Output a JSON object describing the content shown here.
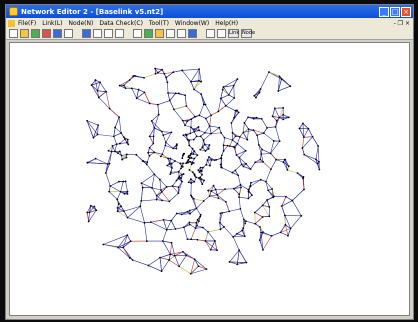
{
  "window": {
    "title": "Network Editor 2 - [Baselink v5.nt2]",
    "controls": [
      "minimize",
      "maximize",
      "close"
    ]
  },
  "menubar": {
    "items": [
      "File(F)",
      "Link(L)",
      "Node(N)",
      "Data Check(C)",
      "Tool(T)",
      "Window(W)",
      "Help(H)"
    ],
    "mdi_controls": "- ❐ ×"
  },
  "toolbar": {
    "icons": [
      "new-file-icon",
      "open-folder-icon",
      "network-icon",
      "import-icon",
      "save-icon",
      "print-icon",
      "node-tool-icon",
      "link-tool-icon",
      "split-icon",
      "delete-icon",
      "measure-icon",
      "chart-icon",
      "route-icon",
      "branch-icon",
      "arrow-icon",
      "rotate-icon",
      "zoom-in-icon",
      "zoom-out-icon"
    ],
    "text_buttons": [
      "Link",
      "Node"
    ]
  },
  "colors": {
    "link_primary": "#2a2fa8",
    "link_secondary": "#c0392b",
    "link_tertiary": "#b9b93a",
    "node": "#000000",
    "title_bar": "#0a4fd8"
  }
}
